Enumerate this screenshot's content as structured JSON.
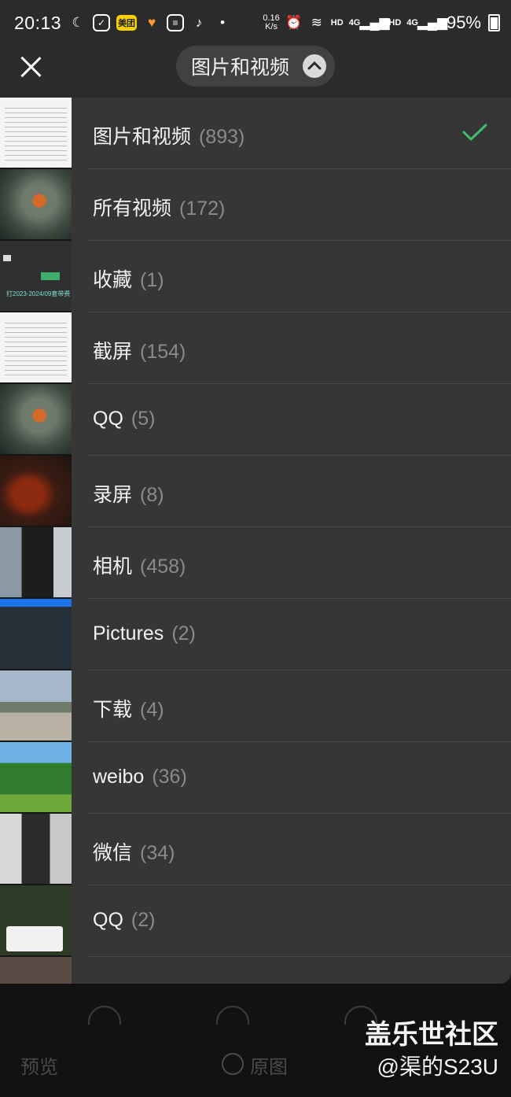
{
  "status_bar": {
    "time": "20:13",
    "net_speed": "0.16\nK/s",
    "hd1": "HD",
    "hd2": "HD",
    "net1": "4G",
    "net2": "4G",
    "battery": "95%",
    "icons": [
      "moon-icon",
      "check-app-icon",
      "meituan-icon",
      "heart-app-icon",
      "doc-icon",
      "tiktok-icon",
      "dot-icon",
      "alarm-icon",
      "wifi-icon",
      "signal-icon",
      "signal-icon",
      "battery-icon"
    ],
    "meituan_label": "美团"
  },
  "header": {
    "album_selector_label": "图片和视频"
  },
  "albums": [
    {
      "name": "图片和视频",
      "count": "(893)",
      "selected": true
    },
    {
      "name": "所有视频",
      "count": "(172)",
      "selected": false
    },
    {
      "name": "收藏",
      "count": "(1)",
      "selected": false
    },
    {
      "name": "截屏",
      "count": "(154)",
      "selected": false
    },
    {
      "name": "QQ",
      "count": "(5)",
      "selected": false
    },
    {
      "name": "录屏",
      "count": "(8)",
      "selected": false
    },
    {
      "name": "相机",
      "count": "(458)",
      "selected": false
    },
    {
      "name": "Pictures",
      "count": "(2)",
      "selected": false
    },
    {
      "name": "下载",
      "count": "(4)",
      "selected": false
    },
    {
      "name": "weibo",
      "count": "(36)",
      "selected": false
    },
    {
      "name": "微信",
      "count": "(34)",
      "selected": false
    },
    {
      "name": "QQ",
      "count": "(2)",
      "selected": false
    }
  ],
  "thumbnail_text": {
    "screenshot_caption": "打2023-2024/09套带费"
  },
  "bottom_bar": {
    "preview_label": "预览",
    "original_label": "原图"
  },
  "watermark": {
    "title": "盖乐世社区",
    "subtitle": "@渠的S23U"
  },
  "colors": {
    "check_color": "#3fbf6a",
    "sheet_bg": "#363636",
    "count_color": "#8a8a8a"
  }
}
